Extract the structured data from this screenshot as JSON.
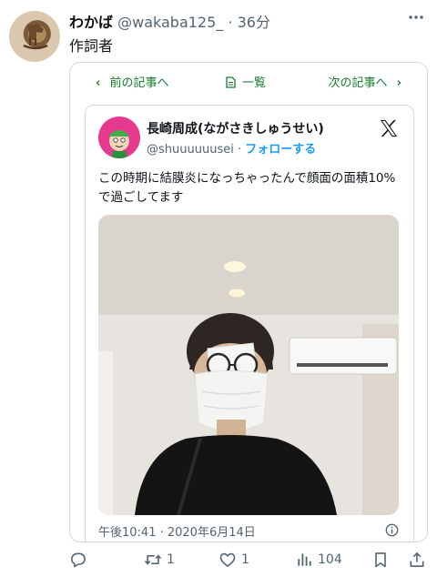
{
  "post": {
    "display_name": "わかば",
    "handle": "@wakaba125_",
    "separator": "·",
    "time": "36分",
    "text": "作詞者"
  },
  "card_nav": {
    "prev_label": "前の記事へ",
    "list_label": "一覧",
    "next_label": "次の記事へ"
  },
  "embedded": {
    "name": "長崎周成(ながさきしゅうせい)",
    "handle": "@shuuuuuusei",
    "separator": "·",
    "follow_label": "フォローする",
    "text": "この時期に結膜炎になっちゃったんで顔面の面積10%で過ごしてます",
    "timestamp": "午後10:41 · 2020年6月14日"
  },
  "actions": {
    "reply_count": "",
    "retweet_count": "1",
    "like_count": "1",
    "views_count": "104"
  },
  "colors": {
    "nav_green": "#1a7a32",
    "link_blue": "#1d9bf0",
    "muted": "#536471",
    "embed_avatar_bg": "#e63a8e"
  },
  "icons": [
    "more-icon",
    "chevron-left-icon",
    "document-icon",
    "chevron-right-icon",
    "x-logo-icon",
    "info-icon",
    "reply-icon",
    "retweet-icon",
    "like-icon",
    "views-icon",
    "bookmark-icon",
    "share-icon"
  ]
}
